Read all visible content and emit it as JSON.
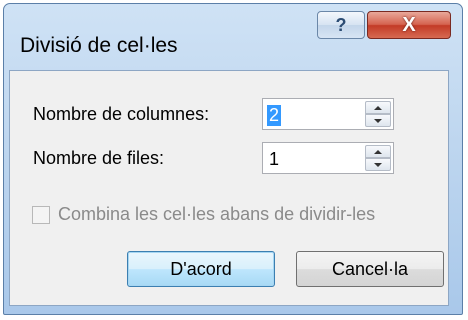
{
  "dialog": {
    "title": "Divisió de cel·les",
    "help_symbol": "?",
    "close_symbol": "X"
  },
  "fields": {
    "columns_label": "Nombre de columnes:",
    "columns_value": "2",
    "rows_label": "Nombre de files:",
    "rows_value": "1"
  },
  "checkbox": {
    "label": "Combina les cel·les abans de dividir-les",
    "checked": false,
    "enabled": false
  },
  "buttons": {
    "ok_label": "D'acord",
    "cancel_label": "Cancel·la"
  }
}
